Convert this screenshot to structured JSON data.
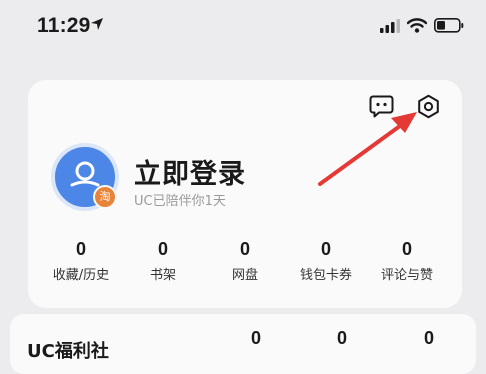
{
  "status_bar": {
    "time": "11:29"
  },
  "account": {
    "login_title": "立即登录",
    "subtitle": "UC已陪伴你1天",
    "avatar_badge": "淘"
  },
  "stats": [
    {
      "value": "0",
      "label": "收藏/历史"
    },
    {
      "value": "0",
      "label": "书架"
    },
    {
      "value": "0",
      "label": "网盘"
    },
    {
      "value": "0",
      "label": "钱包卡券"
    },
    {
      "value": "0",
      "label": "评论与赞"
    }
  ],
  "welfare": {
    "title": "UC福利社",
    "values": [
      "0",
      "0",
      "0"
    ]
  },
  "icons": {
    "top_right": [
      "message-icon",
      "settings-gear-icon"
    ]
  },
  "colors": {
    "accent_blue": "#4c86e6",
    "badge_orange": "#e8843a",
    "annotation_red": "#e53935"
  }
}
